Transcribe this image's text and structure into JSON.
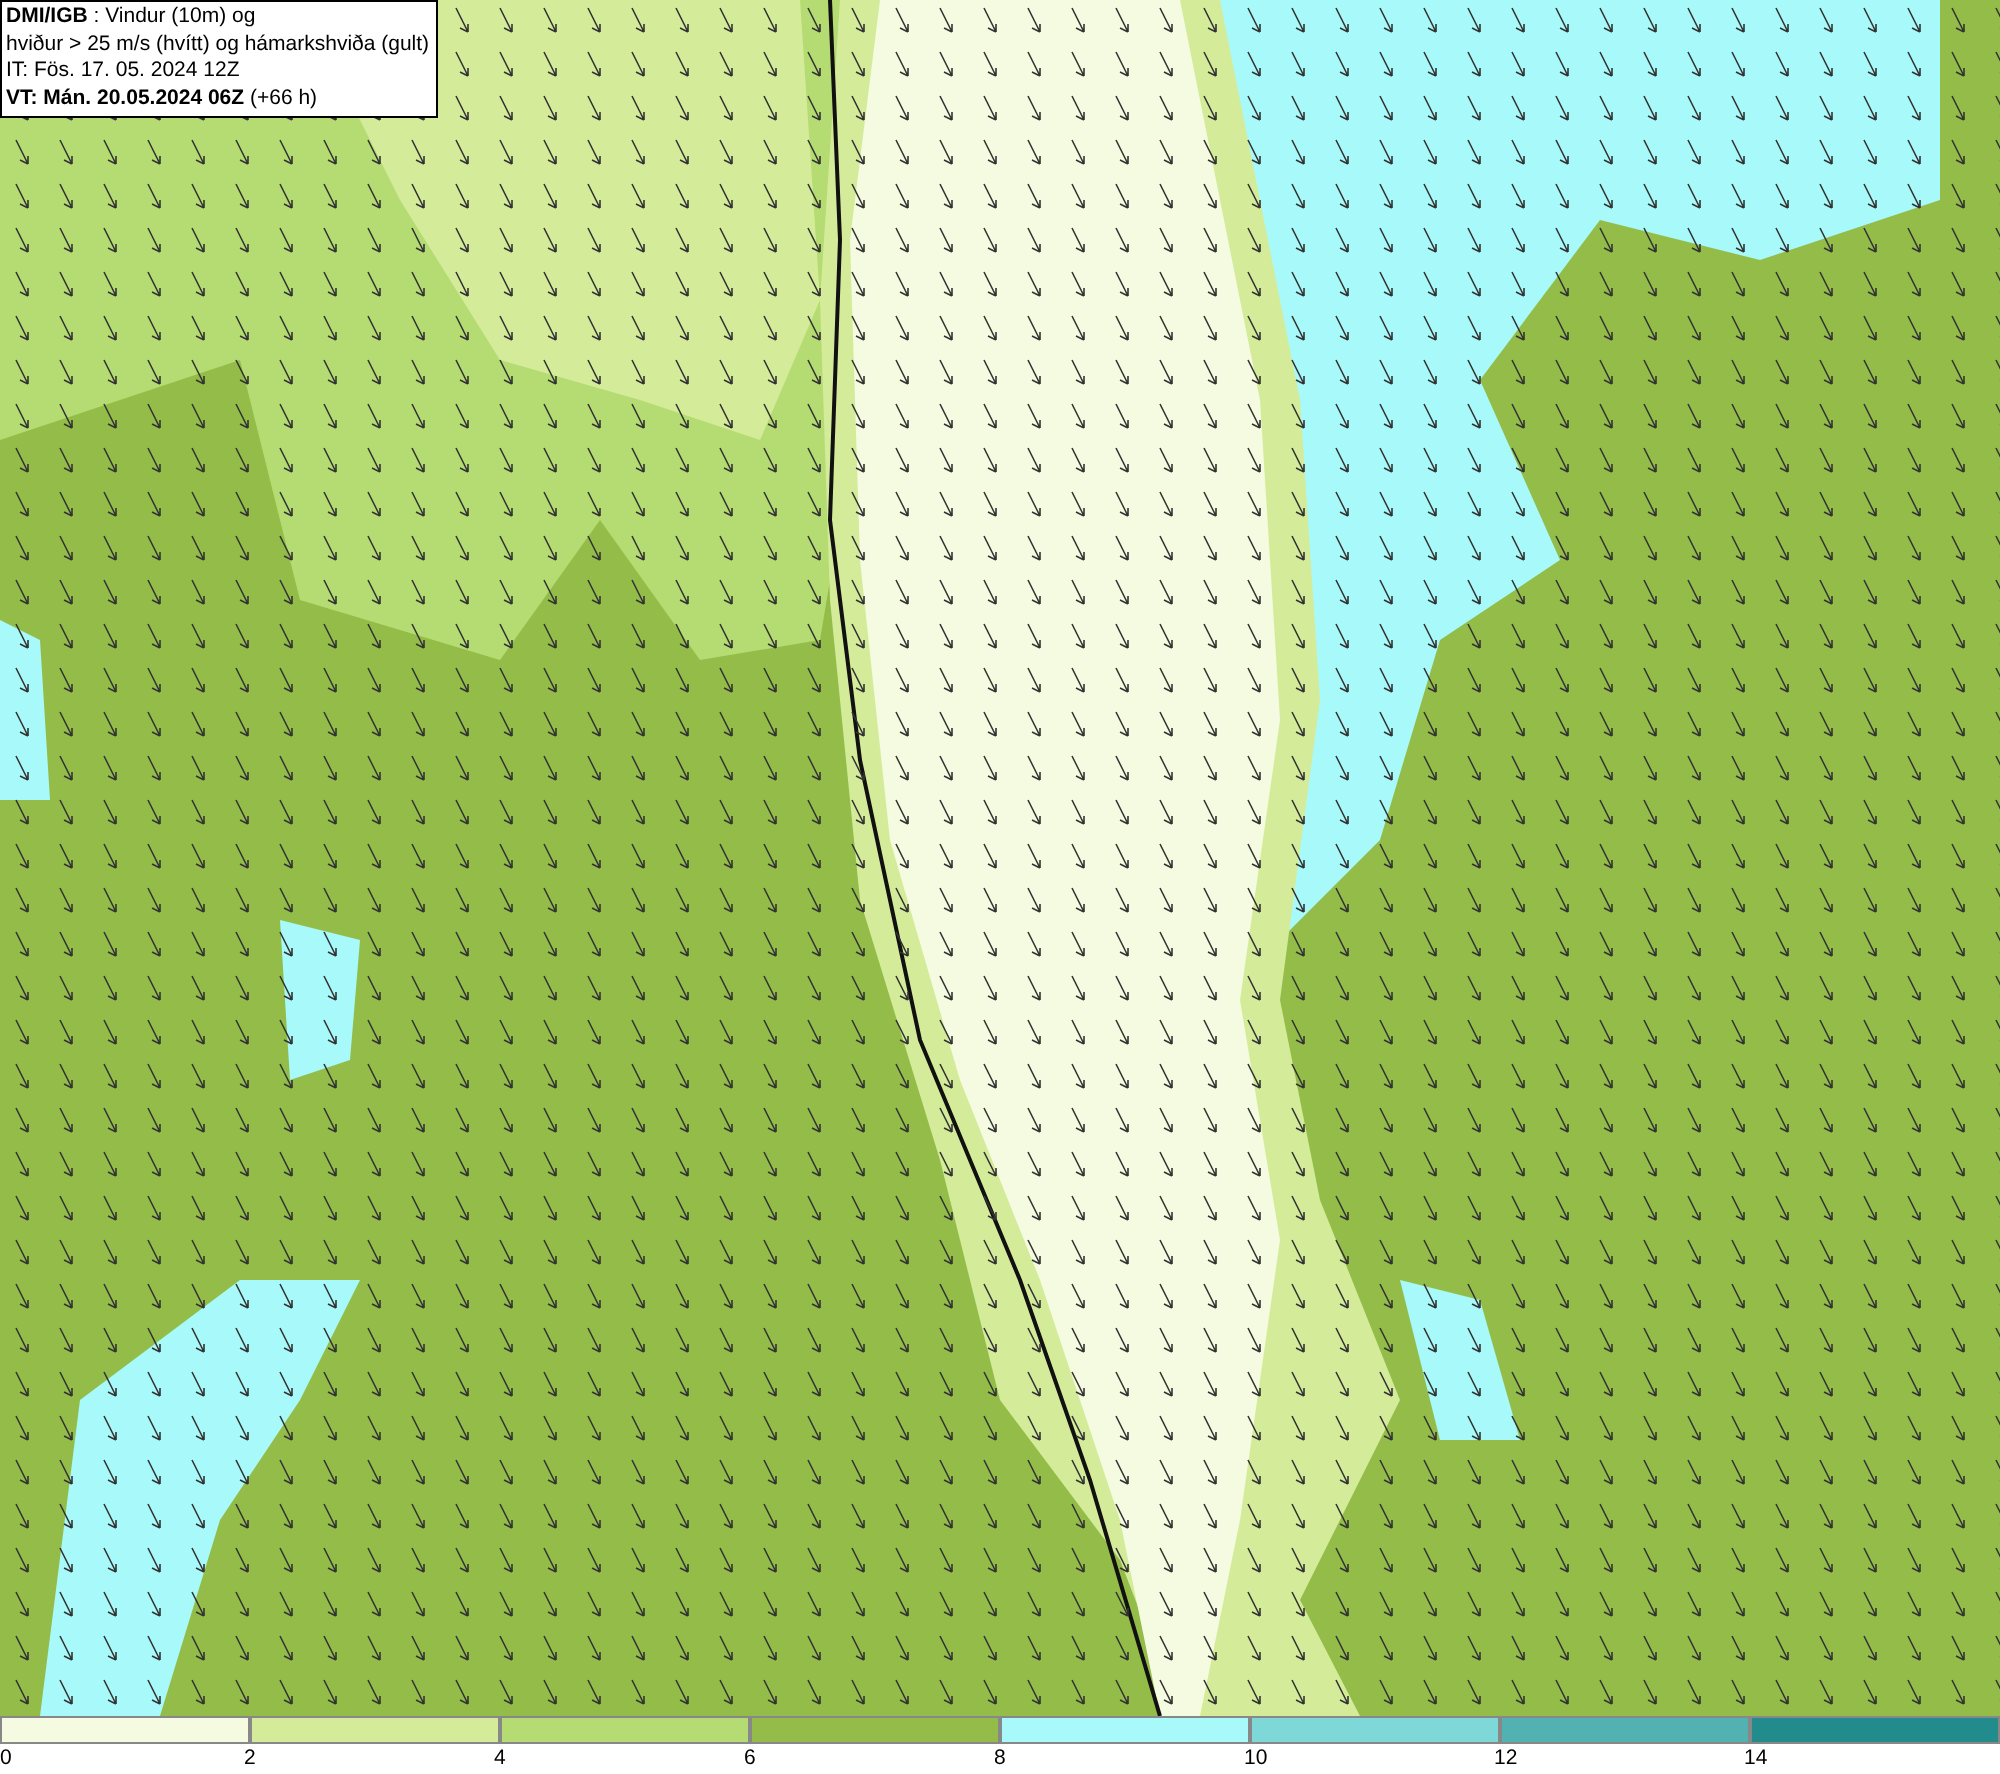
{
  "header": {
    "lines": [
      "**DMI/IGB** : Vindur (10m) og",
      "hviður > 25 m/s (hvítt) og hámarkshviða (gult)",
      "IT: Fös. 17. 05. 2024 12Z",
      "**VT: Mán. 20.05.2024 06Z** (+66 h)"
    ]
  },
  "legend": {
    "bins": [
      {
        "color": "#f5fbe0"
      },
      {
        "color": "#d4ec9a"
      },
      {
        "color": "#b5dc72"
      },
      {
        "color": "#93bd48"
      },
      {
        "color": "#a8fafa"
      },
      {
        "color": "#7fd8d8"
      },
      {
        "color": "#52b2b2"
      },
      {
        "color": "#228c8c"
      }
    ],
    "ticks": [
      "0",
      "2",
      "4",
      "6",
      "8",
      "10",
      "12",
      "14"
    ]
  }
}
